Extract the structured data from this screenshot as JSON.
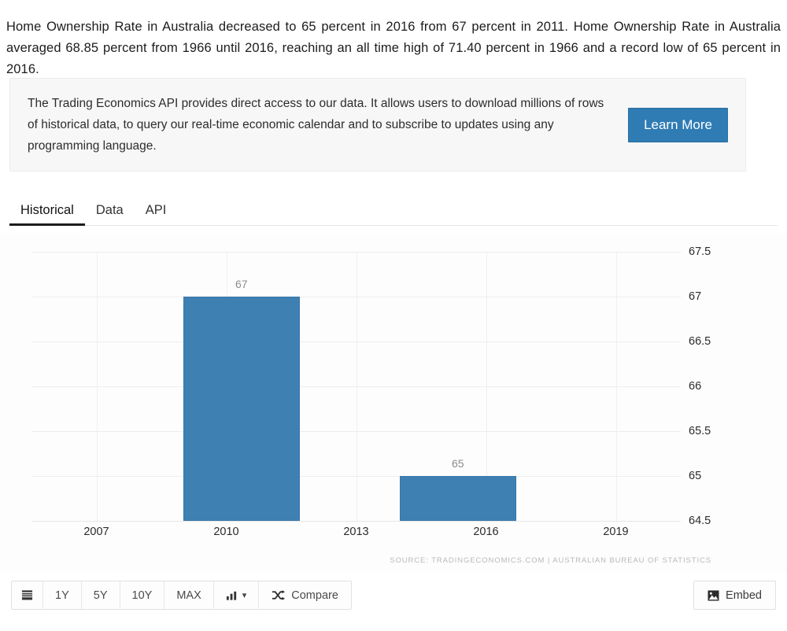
{
  "intro": {
    "text": "Home Ownership Rate in Australia decreased to 65 percent in 2016 from 67 percent in 2011. Home Ownership Rate in Australia averaged 68.85 percent from 1966 until 2016, reaching an all time high of 71.40 percent in 1966 and a record low of 65 percent in 2016."
  },
  "api_banner": {
    "text": "The Trading Economics API provides direct access to our data. It allows users to download millions of rows of historical data, to query our real-time economic calendar and to subscribe to updates using any programming language.",
    "button_label": "Learn More",
    "button_color": "#2f7cb4",
    "background": "#f7f7f7"
  },
  "tabs": [
    {
      "label": "Historical",
      "active": true
    },
    {
      "label": "Data",
      "active": false
    },
    {
      "label": "API",
      "active": false
    }
  ],
  "chart_data": {
    "type": "bar",
    "title": "",
    "xlabel": "",
    "ylabel": "",
    "categories": [
      "2011",
      "2016"
    ],
    "values": [
      67,
      65
    ],
    "data_labels": [
      "67",
      "65"
    ],
    "bar_color": "#3f80b3",
    "grid": true,
    "legend": null,
    "ylim": [
      64.5,
      67.5
    ],
    "ytick_labels": [
      "67.5",
      "67",
      "66.5",
      "66",
      "65.5",
      "65",
      "64.5"
    ],
    "ytick_values": [
      67.5,
      67,
      66.5,
      66,
      65.5,
      65,
      64.5
    ],
    "xtick_labels": [
      "2007",
      "2010",
      "2013",
      "2016",
      "2019"
    ],
    "xtick_values": [
      2007,
      2010,
      2013,
      2016,
      2019
    ],
    "xlim": [
      2005.5,
      2020.5
    ],
    "source": "SOURCE: TRADINGECONOMICS.COM  |  AUSTRALIAN BUREAU OF STATISTICS"
  },
  "toolbar": {
    "list_icon": "list-icon",
    "ranges": [
      "1Y",
      "5Y",
      "10Y",
      "MAX"
    ],
    "chart_type_icon": "bar-chart-icon",
    "chart_type_caret": "▾",
    "compare_label": "Compare",
    "compare_icon": "shuffle-icon",
    "embed_label": "Embed",
    "embed_icon": "image-icon"
  }
}
